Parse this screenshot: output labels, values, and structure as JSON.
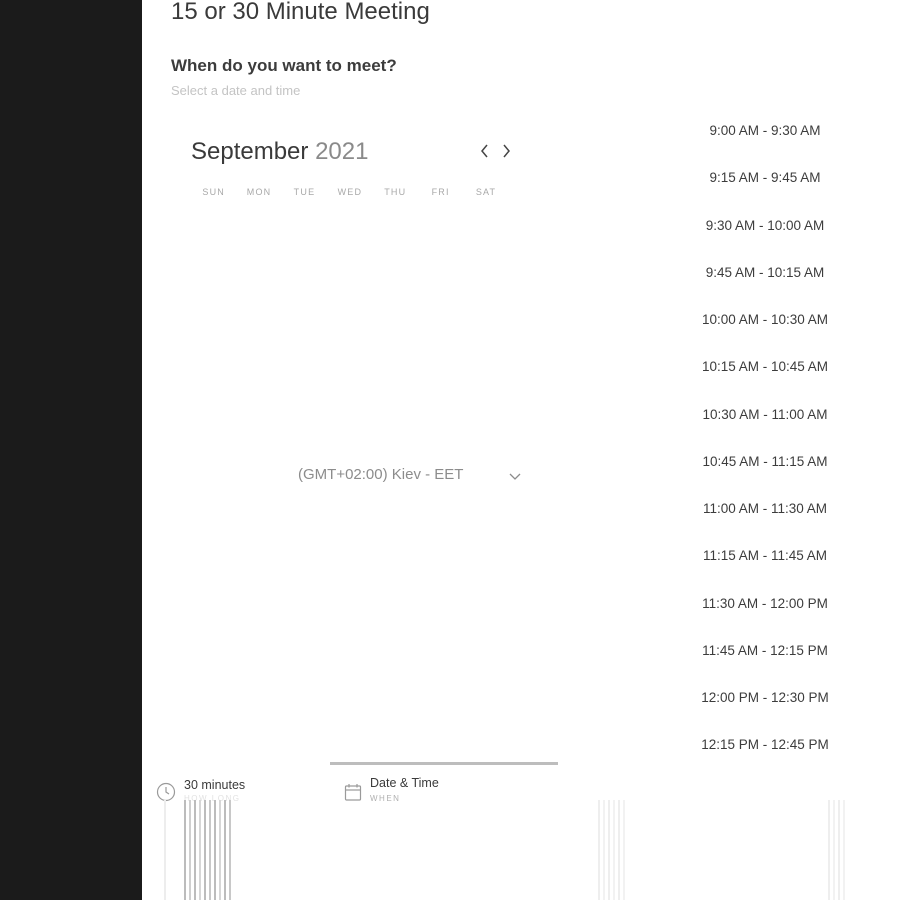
{
  "meeting": {
    "title": "15 or 30 Minute Meeting",
    "question": "When do you want to meet?",
    "hint": "Select a date and time"
  },
  "calendar": {
    "month": "September",
    "year": "2021",
    "weekdays": [
      "SUN",
      "MON",
      "TUE",
      "WED",
      "THU",
      "FRI",
      "SAT"
    ]
  },
  "timezone": {
    "label": "(GMT+02:00) Kiev - EET"
  },
  "time_slots": [
    "9:00 AM - 9:30 AM",
    "9:15 AM - 9:45 AM",
    "9:30 AM - 10:00 AM",
    "9:45 AM - 10:15 AM",
    "10:00 AM - 10:30 AM",
    "10:15 AM - 10:45 AM",
    "10:30 AM - 11:00 AM",
    "10:45 AM - 11:15 AM",
    "11:00 AM - 11:30 AM",
    "11:15 AM - 11:45 AM",
    "11:30 AM - 12:00 PM",
    "11:45 AM - 12:15 PM",
    "12:00 PM - 12:30 PM",
    "12:15 PM - 12:45 PM"
  ],
  "steps": {
    "duration": {
      "title": "30 minutes",
      "sub": "HOW LONG",
      "icon": "clock-icon"
    },
    "datetime": {
      "title": "Date & Time",
      "sub": "WHEN",
      "icon": "calendar-icon"
    }
  },
  "colors": {
    "sidebar": "#1b1b1b",
    "text": "#3c3c3c",
    "muted": "#c4c4c4",
    "progress": "#bdbdbd"
  }
}
